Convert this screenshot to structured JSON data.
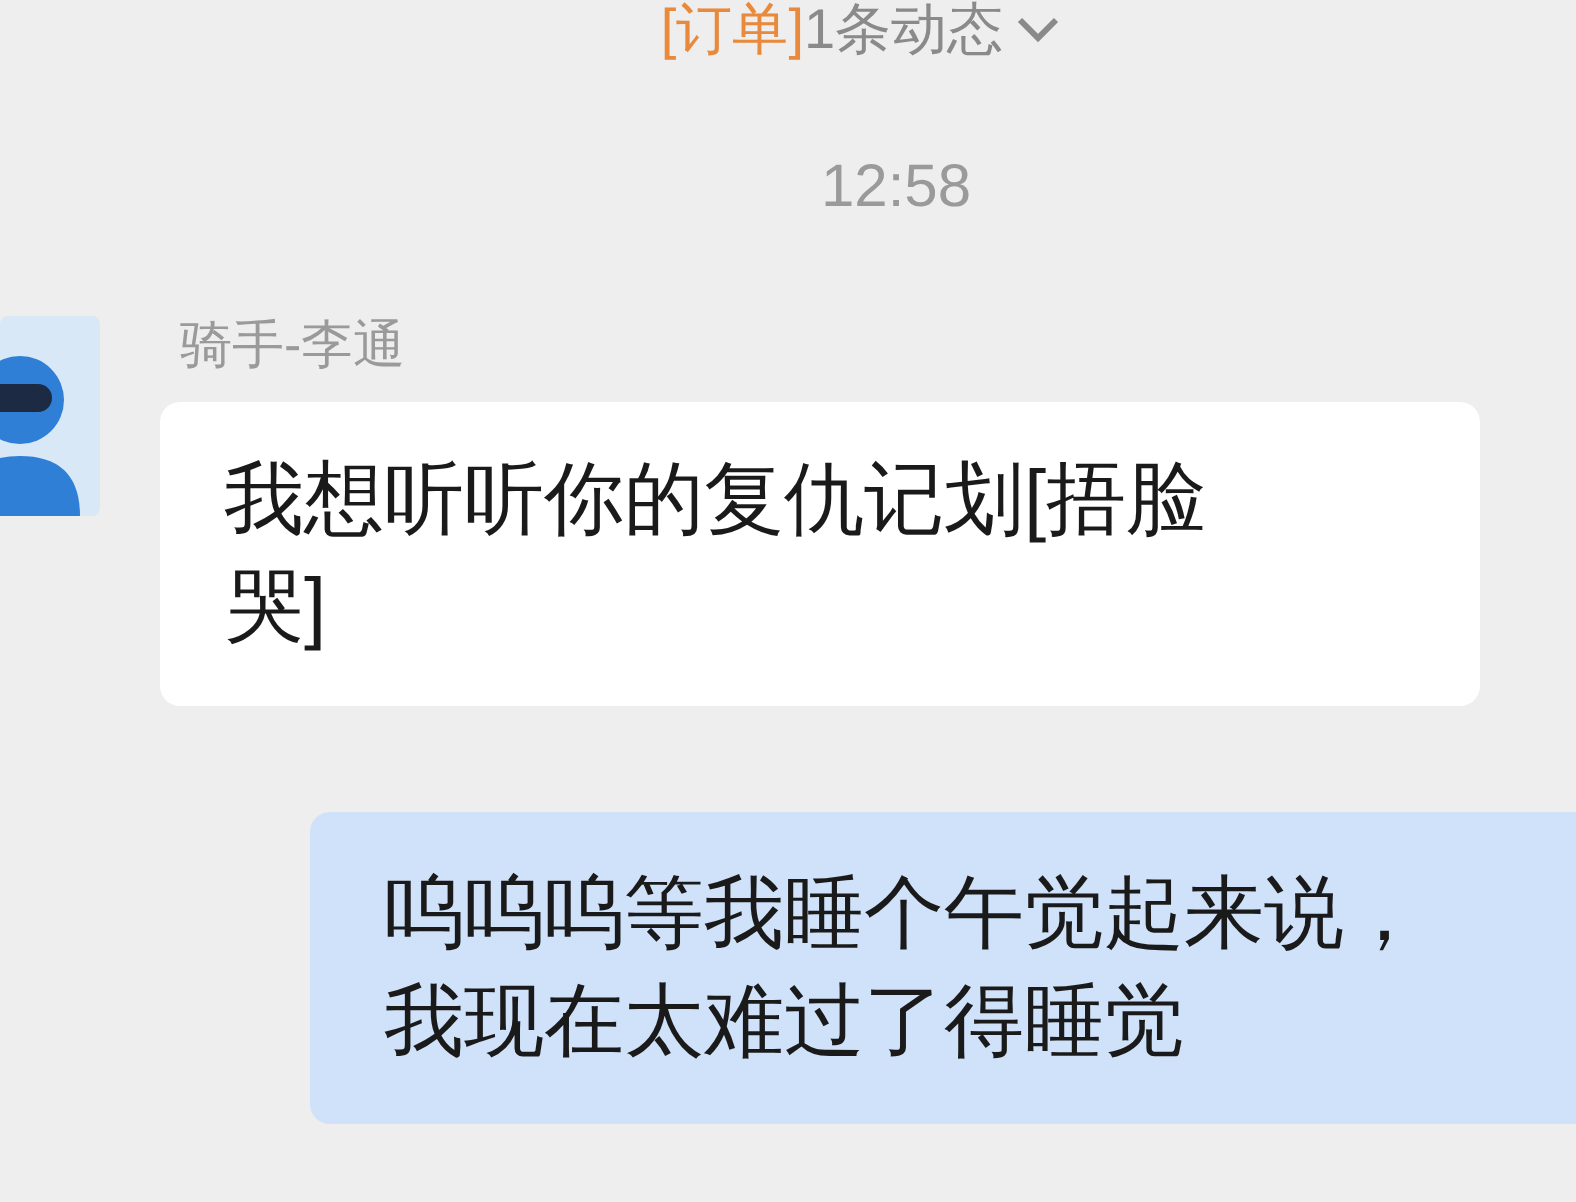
{
  "notice": {
    "tag": "[订单]",
    "text": "1条动态"
  },
  "time": "12:58",
  "messages": [
    {
      "kind": "incoming",
      "sender": "骑手-李通",
      "text": "我想听听你的复仇记划[捂脸哭]"
    },
    {
      "kind": "outgoing",
      "text": "呜呜呜等我睡个午觉起来说，我现在太难过了得睡觉"
    }
  ]
}
